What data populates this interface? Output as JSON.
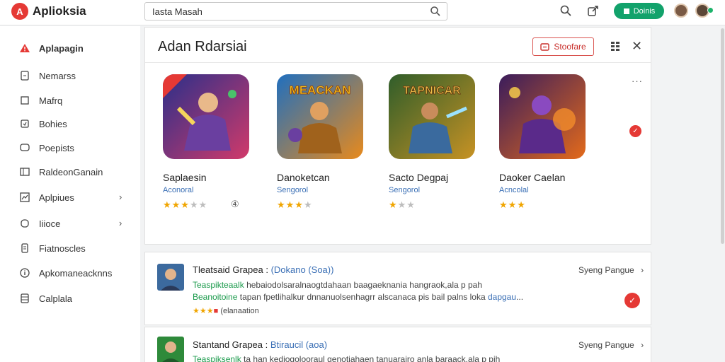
{
  "app": {
    "name": "Aplioksia",
    "logo_letter": "A",
    "accent": "#e53935"
  },
  "search": {
    "value": "Iasta Masah"
  },
  "topbar": {
    "action_label": "Doinis"
  },
  "sidebar": {
    "items": [
      {
        "label": "Aplapagin",
        "icon": "warning-icon",
        "active": true
      },
      {
        "label": "Nemarss",
        "icon": "doc-icon"
      },
      {
        "label": "Mafrq",
        "icon": "square-icon"
      },
      {
        "label": "Bohies",
        "icon": "checkbox-icon"
      },
      {
        "label": "Poepists",
        "icon": "chat-icon"
      },
      {
        "label": "RaldeonGanain",
        "icon": "frame-icon"
      },
      {
        "label": "Aplpiues",
        "icon": "chart-icon",
        "chevron": "›"
      },
      {
        "label": "Iiioce",
        "icon": "bookmark-icon",
        "chevron": "›"
      },
      {
        "label": "Fiatnoscles",
        "icon": "document-icon"
      },
      {
        "label": "Apkomaneacknns",
        "icon": "info-icon"
      },
      {
        "label": "Calplala",
        "icon": "list-icon"
      }
    ]
  },
  "featured": {
    "title": "Adan Rdarsiai",
    "button_label": "Stoofare",
    "more_label": "···",
    "games": [
      {
        "name": "Saplaesin",
        "category": "Aconoral",
        "stars": 3,
        "badge": "④",
        "art_title": "",
        "c1": "#2a2f8a",
        "c2": "#d13a6a"
      },
      {
        "name": "Danoketcan",
        "category": "Sengorol",
        "stars": 3,
        "art_title": "MEACKAN",
        "c1": "#1f6fbf",
        "c2": "#e88a1c"
      },
      {
        "name": "Sacto Degpaj",
        "category": "Sengorol",
        "stars": 1,
        "art_title": "TAPNICAR",
        "c1": "#2f5d2a",
        "c2": "#c79224"
      },
      {
        "name": "Daoker Caelan",
        "category": "Acncolal",
        "stars": 3,
        "art_title": "",
        "c1": "#3a1c5c",
        "c2": "#e36a1b"
      }
    ]
  },
  "list": {
    "rows": [
      {
        "title": "Tleatsaid Grapea :",
        "tag": "(Dokano (Soa))",
        "lead": "Teaspikteaalk",
        "line1": "hebaiodolsaralnaogtdahaan baagaeknania hangraok,ala p pah",
        "lead2": "Beanoitoine",
        "line2": "tapan fpetlihalkur dnnanuolsenhagrr alscanaca pis bail palns loka",
        "tail2": "dapgau",
        "meta": "(elanaation",
        "meta_stars": 3,
        "link": "Syeng Pangue",
        "avatar_bg": "#3c6a9e"
      },
      {
        "title": "Stantand Grapea :",
        "tag": "Btiraucil (aoa)",
        "lead": "Teaspiksenlk",
        "line1": "ta han kediogolooraul genotiahaen tanuarairo anla baraack,ala p pih",
        "link": "Syeng Pangue",
        "avatar_bg": "#2e8a3a"
      }
    ]
  }
}
